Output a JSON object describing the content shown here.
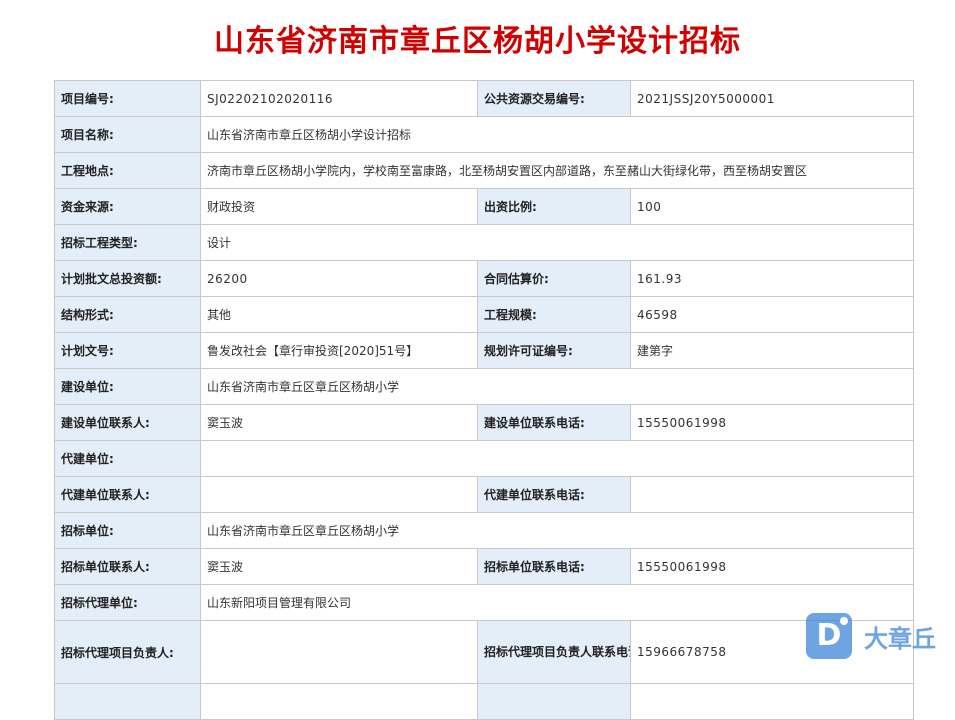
{
  "title": "山东省济南市章丘区杨胡小学设计招标",
  "fields": {
    "project_no_label": "项目编号:",
    "project_no": "SJ02202102020116",
    "trade_no_label": "公共资源交易编号:",
    "trade_no": "2021JSSJ20Y5000001",
    "name_label": "项目名称:",
    "name": "山东省济南市章丘区杨胡小学设计招标",
    "location_label": "工程地点:",
    "location": "济南市章丘区杨胡小学院内，学校南至富康路，北至杨胡安置区内部道路，东至赭山大街绿化带，西至杨胡安置区",
    "fund_label": "资金来源:",
    "fund": "财政投资",
    "ratio_label": "出资比例:",
    "ratio": "100",
    "type_label": "招标工程类型:",
    "type": "设计",
    "invest_label": "计划批文总投资额:",
    "invest": "26200",
    "contract_label": "合同估算价:",
    "contract": "161.93",
    "structure_label": "结构形式:",
    "structure": "其他",
    "scale_label": "工程规模:",
    "scale": "46598",
    "plan_doc_label": "计划文号:",
    "plan_doc": "鲁发改社会【章行审投资[2020]51号】",
    "permit_label": "规划许可证编号:",
    "permit": "建第字",
    "builder_label": "建设单位:",
    "builder": "山东省济南市章丘区章丘区杨胡小学",
    "builder_contact_label": "建设单位联系人:",
    "builder_contact": "窦玉波",
    "builder_phone_label": "建设单位联系电话:",
    "builder_phone": "15550061998",
    "agent_builder_label": "代建单位:",
    "agent_builder": "",
    "agent_builder_contact_label": "代建单位联系人:",
    "agent_builder_contact": "",
    "agent_builder_phone_label": "代建单位联系电话:",
    "agent_builder_phone": "",
    "tenderer_label": "招标单位:",
    "tenderer": "山东省济南市章丘区章丘区杨胡小学",
    "tenderer_contact_label": "招标单位联系人:",
    "tenderer_contact": "窦玉波",
    "tenderer_phone_label": "招标单位联系电话:",
    "tenderer_phone": "15550061998",
    "agency_label": "招标代理单位:",
    "agency": "山东新阳项目管理有限公司",
    "agency_lead_label": "招标代理项目负责人:",
    "agency_lead": "",
    "agency_phone_label": "招标代理项目负责人联系电话（手机）:",
    "agency_phone": "15966678758"
  },
  "watermark": {
    "logo_letter": "D",
    "text": "大章丘",
    "color": "#3f86d9"
  }
}
